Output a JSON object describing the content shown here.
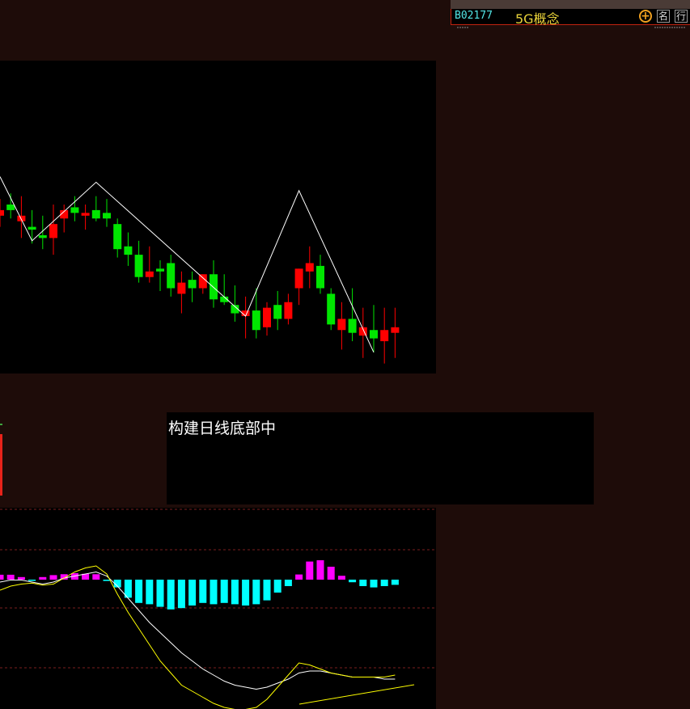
{
  "quote_bar": {
    "code": "B02177",
    "name": "5G概念",
    "add_button": "+",
    "rank_button": "名",
    "industry_button": "行"
  },
  "status_box": {
    "text": "构建日线底部中"
  },
  "colors": {
    "background": "#1e0c09",
    "panel": "#000000",
    "up_candle": "#ff0000",
    "down_candle": "#00e600",
    "zigzag": "#ffffff",
    "macd_positive": "#ff00ff",
    "macd_negative": "#00ffff",
    "dif_line": "#ffffff",
    "dea_line": "#ffff00"
  },
  "chart_data": [
    {
      "type": "candlestick",
      "title": "",
      "price_range": [
        0,
        100
      ],
      "candles": [
        {
          "o": 56,
          "h": 62,
          "l": 52,
          "c": 58
        },
        {
          "o": 60,
          "h": 64,
          "l": 55,
          "c": 58
        },
        {
          "o": 54,
          "h": 63,
          "l": 48,
          "c": 56
        },
        {
          "o": 52,
          "h": 58,
          "l": 46,
          "c": 51
        },
        {
          "o": 49,
          "h": 56,
          "l": 44,
          "c": 48
        },
        {
          "o": 48,
          "h": 60,
          "l": 42,
          "c": 53
        },
        {
          "o": 55,
          "h": 60,
          "l": 50,
          "c": 58
        },
        {
          "o": 59,
          "h": 63,
          "l": 54,
          "c": 57
        },
        {
          "o": 56,
          "h": 60,
          "l": 51,
          "c": 57
        },
        {
          "o": 58,
          "h": 63,
          "l": 54,
          "c": 55
        },
        {
          "o": 57,
          "h": 62,
          "l": 52,
          "c": 55
        },
        {
          "o": 53,
          "h": 55,
          "l": 41,
          "c": 44
        },
        {
          "o": 45,
          "h": 50,
          "l": 38,
          "c": 42
        },
        {
          "o": 42,
          "h": 47,
          "l": 32,
          "c": 34
        },
        {
          "o": 34,
          "h": 45,
          "l": 32,
          "c": 36
        },
        {
          "o": 37,
          "h": 40,
          "l": 29,
          "c": 36
        },
        {
          "o": 39,
          "h": 42,
          "l": 27,
          "c": 30
        },
        {
          "o": 28,
          "h": 36,
          "l": 21,
          "c": 32
        },
        {
          "o": 33,
          "h": 36,
          "l": 25,
          "c": 30
        },
        {
          "o": 30,
          "h": 35,
          "l": 28,
          "c": 35
        },
        {
          "o": 35,
          "h": 40,
          "l": 23,
          "c": 26
        },
        {
          "o": 27,
          "h": 35,
          "l": 24,
          "c": 25
        },
        {
          "o": 24,
          "h": 31,
          "l": 18,
          "c": 21
        },
        {
          "o": 20,
          "h": 27,
          "l": 12,
          "c": 22
        },
        {
          "o": 22,
          "h": 30,
          "l": 12,
          "c": 15
        },
        {
          "o": 16,
          "h": 25,
          "l": 13,
          "c": 23
        },
        {
          "o": 24,
          "h": 29,
          "l": 15,
          "c": 19
        },
        {
          "o": 19,
          "h": 28,
          "l": 17,
          "c": 25
        },
        {
          "o": 30,
          "h": 37,
          "l": 24,
          "c": 37
        },
        {
          "o": 36,
          "h": 45,
          "l": 30,
          "c": 39
        },
        {
          "o": 38,
          "h": 42,
          "l": 28,
          "c": 30
        },
        {
          "o": 28,
          "h": 30,
          "l": 15,
          "c": 17
        },
        {
          "o": 15,
          "h": 25,
          "l": 8,
          "c": 19
        },
        {
          "o": 19,
          "h": 30,
          "l": 11,
          "c": 14
        },
        {
          "o": 13,
          "h": 23,
          "l": 5,
          "c": 16
        },
        {
          "o": 15,
          "h": 24,
          "l": 7,
          "c": 12
        },
        {
          "o": 11,
          "h": 23,
          "l": 3,
          "c": 15
        },
        {
          "o": 14,
          "h": 23,
          "l": 5,
          "c": 16
        }
      ],
      "zigzag": [
        [
          0,
          70
        ],
        [
          3,
          47
        ],
        [
          9,
          68
        ],
        [
          23,
          20
        ],
        [
          28,
          65
        ],
        [
          35,
          7
        ]
      ]
    },
    {
      "type": "bar",
      "title": "",
      "ylim": [
        -3,
        3
      ],
      "macd": [
        0.38,
        0.38,
        0.2,
        -0.05,
        0.2,
        0.35,
        0.42,
        0.5,
        0.45,
        0.42,
        -0.1,
        -0.6,
        -1.4,
        -1.8,
        -1.9,
        -2.1,
        -2.3,
        -2.2,
        -2.0,
        -1.8,
        -1.9,
        -1.8,
        -1.9,
        -2.0,
        -1.9,
        -1.6,
        -1.0,
        -0.5,
        0.4,
        1.4,
        1.5,
        1.0,
        0.3,
        -0.2,
        -0.5,
        -0.6,
        -0.5,
        -0.4
      ],
      "series": [
        {
          "values": [
            0.8,
            0.9,
            0.9,
            0.8,
            0.7,
            0.8,
            1.0,
            1.1,
            1.2,
            1.3,
            1.1,
            0.6,
            0.0,
            -0.6,
            -1.2,
            -1.7,
            -2.2,
            -2.7,
            -3.1,
            -3.5,
            -3.8,
            -4.1,
            -4.3,
            -4.4,
            -4.5,
            -4.4,
            -4.2,
            -4.0,
            -3.7,
            -3.6,
            -3.6,
            -3.7,
            -3.8,
            -3.9,
            -3.9,
            -3.9,
            -4.0,
            -4.0
          ]
        },
        {
          "values": [
            0.4,
            0.6,
            0.7,
            0.75,
            0.65,
            0.7,
            1.0,
            1.3,
            1.5,
            1.6,
            1.2,
            0.2,
            -0.7,
            -1.5,
            -2.3,
            -3.1,
            -3.7,
            -4.3,
            -4.6,
            -4.9,
            -5.2,
            -5.4,
            -5.5,
            -5.5,
            -5.4,
            -5.0,
            -4.4,
            -3.8,
            -3.2,
            -3.3,
            -3.5,
            -3.7,
            -3.8,
            -3.9,
            -3.9,
            -3.9,
            -3.9,
            -3.8
          ]
        }
      ]
    }
  ]
}
